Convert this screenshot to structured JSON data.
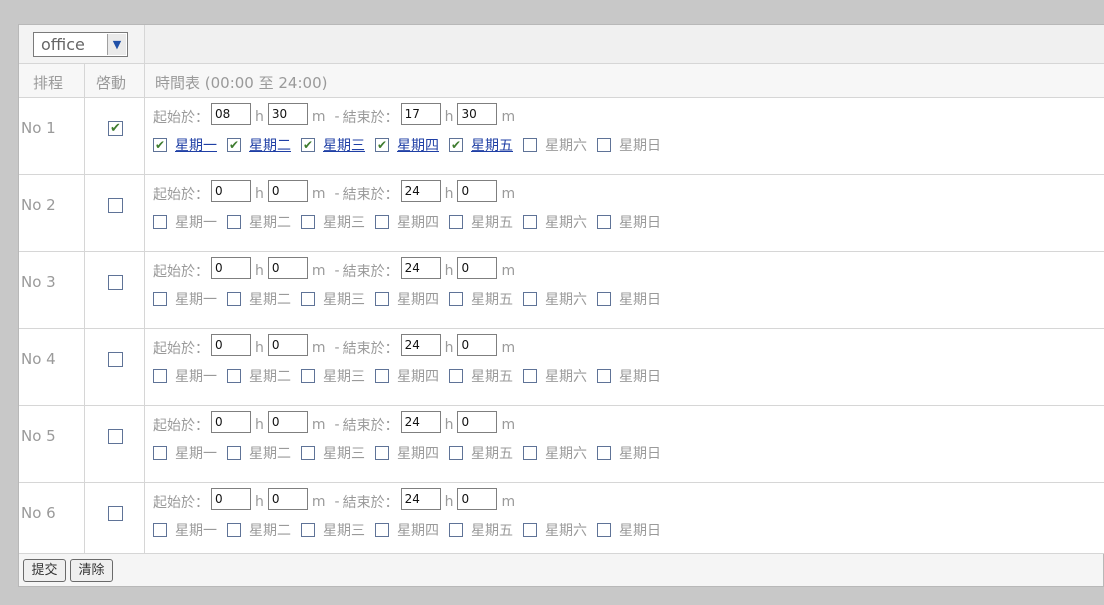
{
  "profile_select": {
    "value": "office"
  },
  "header": {
    "col_schedule": "排程",
    "col_enable": "啓動",
    "col_timetable": "時間表 (00:00 至 24:00)"
  },
  "labels": {
    "start": "起始於：",
    "end": "結束於：",
    "hour_unit": "h",
    "minute_unit": "m",
    "dash": "-"
  },
  "days": [
    "星期一",
    "星期二",
    "星期三",
    "星期四",
    "星期五",
    "星期六",
    "星期日"
  ],
  "schedules": [
    {
      "name": "No 1",
      "enabled": true,
      "start_h": "08",
      "start_m": "30",
      "end_h": "17",
      "end_m": "30",
      "days": [
        true,
        true,
        true,
        true,
        true,
        false,
        false
      ]
    },
    {
      "name": "No 2",
      "enabled": false,
      "start_h": "0",
      "start_m": "0",
      "end_h": "24",
      "end_m": "0",
      "days": [
        false,
        false,
        false,
        false,
        false,
        false,
        false
      ]
    },
    {
      "name": "No 3",
      "enabled": false,
      "start_h": "0",
      "start_m": "0",
      "end_h": "24",
      "end_m": "0",
      "days": [
        false,
        false,
        false,
        false,
        false,
        false,
        false
      ]
    },
    {
      "name": "No 4",
      "enabled": false,
      "start_h": "0",
      "start_m": "0",
      "end_h": "24",
      "end_m": "0",
      "days": [
        false,
        false,
        false,
        false,
        false,
        false,
        false
      ]
    },
    {
      "name": "No 5",
      "enabled": false,
      "start_h": "0",
      "start_m": "0",
      "end_h": "24",
      "end_m": "0",
      "days": [
        false,
        false,
        false,
        false,
        false,
        false,
        false
      ]
    },
    {
      "name": "No 6",
      "enabled": false,
      "start_h": "0",
      "start_m": "0",
      "end_h": "24",
      "end_m": "0",
      "days": [
        false,
        false,
        false,
        false,
        false,
        false,
        false
      ]
    }
  ],
  "buttons": {
    "submit": "提交",
    "clear": "清除"
  },
  "icons": {
    "select_arrow": "chevron-down-icon",
    "checked": "checkmark-icon"
  },
  "colors": {
    "active_day_link": "#1f3fa5",
    "checkmark": "#3f7c2f"
  }
}
